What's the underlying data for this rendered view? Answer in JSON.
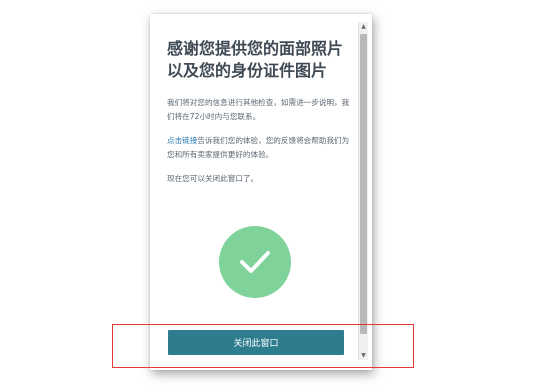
{
  "dialog": {
    "title_line1": "感谢您提供您的面部照片",
    "title_line2": "以及您的身份证件图片",
    "paragraph1": "我们将对您的信息进行其他检查，如需进一步说明，我们将在72小时内与您联系。",
    "paragraph2_link": "点击链接",
    "paragraph2_rest": "告诉我们您的体验，您的反馈将会帮助我们为您和所有卖家提供更好的体验。",
    "paragraph3": "现在您可以关闭此窗口了。",
    "close_button_label": "关闭此窗口"
  },
  "icons": {
    "success": "check-icon",
    "scroll_up": "chevron-up-icon",
    "scroll_down": "chevron-down-icon"
  },
  "colors": {
    "button": "#2e7d8e",
    "check_circle": "#7ed29a",
    "link": "#2a7ab0",
    "highlight_box": "#e53935",
    "title": "#3f4a55"
  }
}
